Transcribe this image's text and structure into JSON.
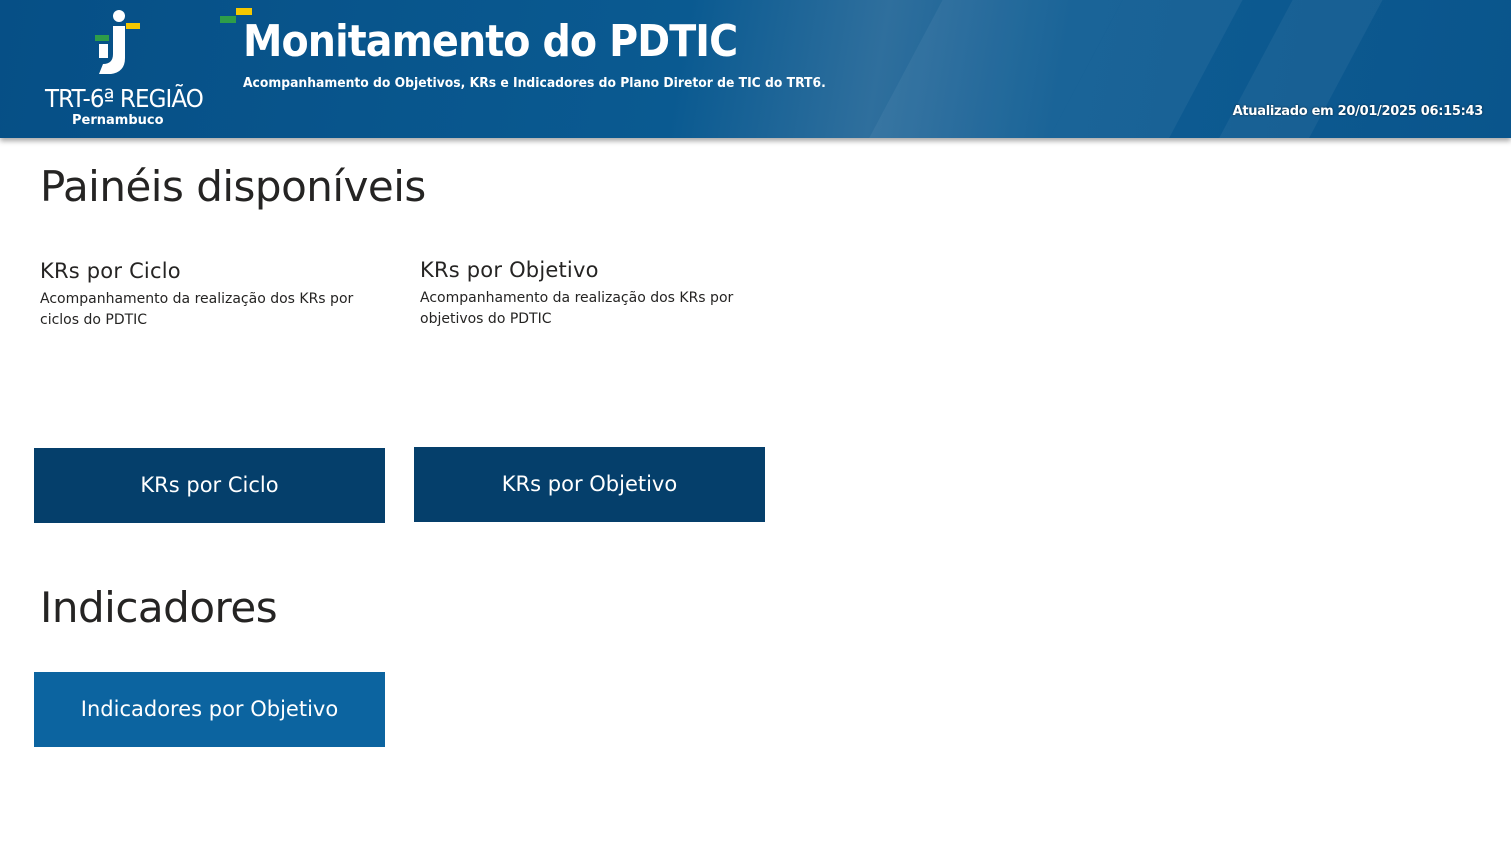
{
  "header": {
    "logo": {
      "name": "TRT-6ª REGIÃO",
      "subtitle": "Pernambuco",
      "icon": "trt6-logo-icon"
    },
    "title": "Monitamento do PDTIC",
    "subtitle": "Acompanhamento do Objetivos, KRs e Indicadores do  Plano Diretor de TIC do TRT6.",
    "updated": "Atualizado em 20/01/2025 06:15:43",
    "colors": {
      "background": "#0a558c",
      "accent_yellow": "#f5c800",
      "accent_green": "#2e9d49"
    }
  },
  "panels": {
    "heading": "Painéis disponíveis",
    "cards": [
      {
        "title": "KRs por Ciclo",
        "description": "Acompanhamento da realização dos KRs por ciclos do PDTIC",
        "button": "KRs por Ciclo"
      },
      {
        "title": "KRs por Objetivo",
        "description": "Acompanhamento da realização dos KRs por objetivos do PDTIC",
        "button": "KRs por Objetivo"
      }
    ],
    "button_color": "#053f6b"
  },
  "indicators": {
    "heading": "Indicadores",
    "button": "Indicadores por Objetivo",
    "button_color": "#0c64a0"
  }
}
